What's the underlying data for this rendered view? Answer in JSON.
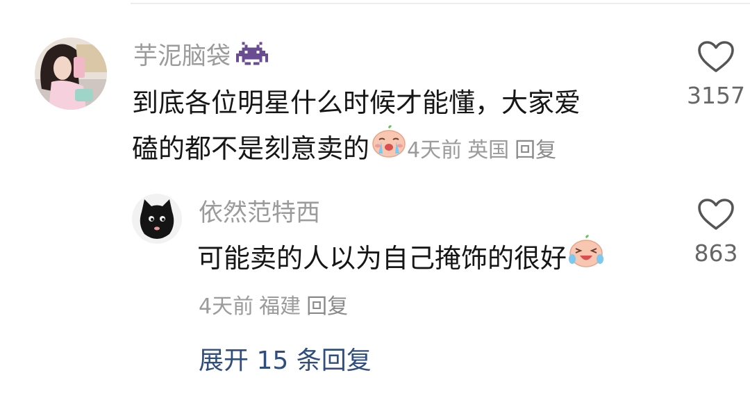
{
  "comment": {
    "username": "芋泥脑袋",
    "username_badge_icon": "space-invader-icon",
    "text_line1": "到底各位明星什么时候才能懂，大家爱",
    "text_line2": "磕的都不是刻意卖的",
    "inline_emoji_icon": "crying-face-icon",
    "time": "4天前",
    "location": "英国",
    "reply_label": "回复",
    "like_count": "3157"
  },
  "reply": {
    "username": "依然范特西",
    "text": "可能卖的人以为自己掩饰的很好",
    "inline_emoji_icon": "laughing-tears-face-icon",
    "time": "4天前",
    "location": "福建",
    "reply_label": "回复",
    "like_count": "863"
  },
  "expand_replies": {
    "label": "展开 15 条回复"
  },
  "colors": {
    "meta": "#9b9b9b",
    "expand_link": "#2f4d7d",
    "badge_purple": "#6a4c93"
  }
}
